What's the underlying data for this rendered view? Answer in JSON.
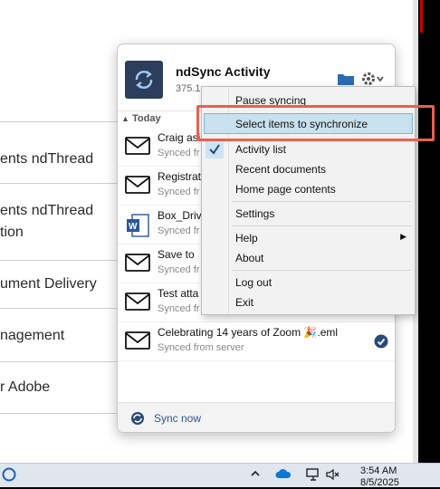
{
  "background": {
    "rows": [
      "ents ndThread",
      "ents ndThread",
      "tion",
      "ument Delivery",
      "nagement",
      "r Adobe"
    ]
  },
  "panel": {
    "title": "ndSync Activity",
    "subtitle": "375.1",
    "section": "Today",
    "items": [
      {
        "name": "Craig asi",
        "status": "Synced fr",
        "icon": "mail-icon"
      },
      {
        "name": "Registrat",
        "status": "Synced fr",
        "icon": "mail-icon"
      },
      {
        "name": "Box_Drive",
        "status": "Synced fr",
        "icon": "word-doc-icon"
      },
      {
        "name": "Save to",
        "status": "Synced fr",
        "icon": "mail-icon"
      },
      {
        "name": "Test atta",
        "status": "Synced fr",
        "icon": "mail-icon"
      },
      {
        "name": "Celebrating 14 years of Zoom 🎉.eml",
        "status": "Synced from server",
        "icon": "mail-icon"
      }
    ],
    "footer": "Sync now"
  },
  "menu": {
    "items": [
      {
        "label": "Pause syncing"
      },
      {
        "label": "Select items to synchronize"
      },
      {
        "label": "Activity list"
      },
      {
        "label": "Recent documents"
      },
      {
        "label": "Home page contents"
      },
      {
        "label": "Settings"
      },
      {
        "label": "Help"
      },
      {
        "label": "About"
      },
      {
        "label": "Log out"
      },
      {
        "label": "Exit"
      }
    ]
  },
  "taskbar": {
    "time": "3:54 AM",
    "date": "8/5/2025"
  },
  "colors": {
    "accent": "#2b5797",
    "highlight": "#e8614f",
    "selection": "#c8e1ef"
  }
}
